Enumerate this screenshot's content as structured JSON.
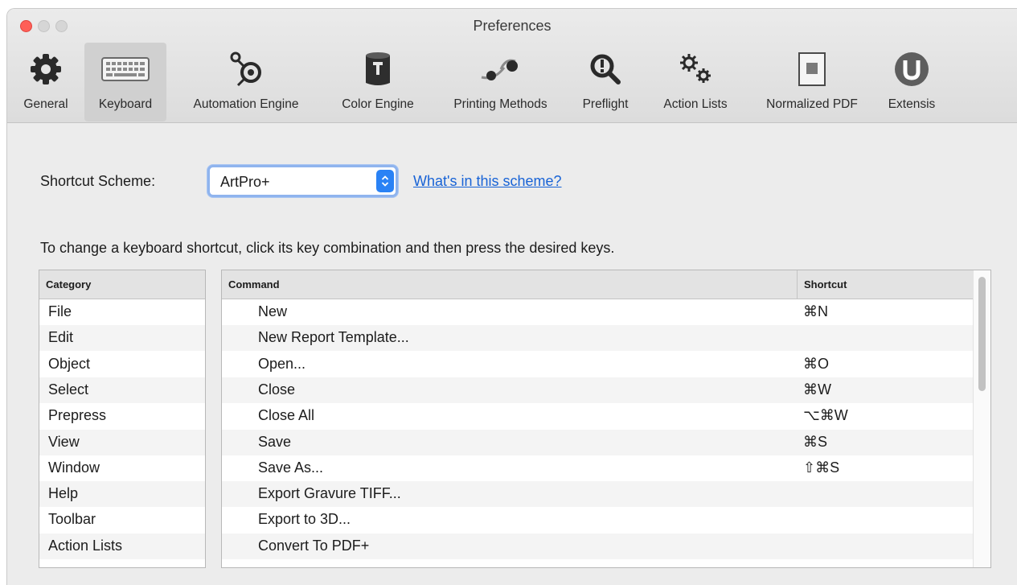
{
  "window": {
    "title": "Preferences"
  },
  "toolbar": {
    "items": [
      {
        "label": "General",
        "icon": "gear-icon",
        "selected": false
      },
      {
        "label": "Keyboard",
        "icon": "keyboard-icon",
        "selected": true
      },
      {
        "label": "Automation Engine",
        "icon": "automation-icon",
        "selected": false
      },
      {
        "label": "Color Engine",
        "icon": "color-engine-icon",
        "selected": false
      },
      {
        "label": "Printing Methods",
        "icon": "printing-methods-icon",
        "selected": false
      },
      {
        "label": "Preflight",
        "icon": "preflight-icon",
        "selected": false
      },
      {
        "label": "Action Lists",
        "icon": "action-lists-icon",
        "selected": false
      },
      {
        "label": "Normalized PDF",
        "icon": "normalized-pdf-icon",
        "selected": false
      },
      {
        "label": "Extensis",
        "icon": "extensis-icon",
        "selected": false
      }
    ]
  },
  "scheme": {
    "label": "Shortcut Scheme:",
    "selected": "ArtPro+",
    "link": "What's in this scheme?"
  },
  "instructions": "To change a keyboard shortcut, click its key combination and then press the desired keys.",
  "categories": {
    "header": "Category",
    "items": [
      "File",
      "Edit",
      "Object",
      "Select",
      "Prepress",
      "View",
      "Window",
      "Help",
      "Toolbar",
      "Action Lists"
    ]
  },
  "commands": {
    "headers": {
      "command": "Command",
      "shortcut": "Shortcut"
    },
    "rows": [
      {
        "command": "New",
        "shortcut": "⌘N"
      },
      {
        "command": "New Report Template...",
        "shortcut": ""
      },
      {
        "command": "Open...",
        "shortcut": "⌘O"
      },
      {
        "command": "Close",
        "shortcut": "⌘W"
      },
      {
        "command": "Close All",
        "shortcut": "⌥⌘W"
      },
      {
        "command": "Save",
        "shortcut": "⌘S"
      },
      {
        "command": "Save As...",
        "shortcut": "⇧⌘S"
      },
      {
        "command": "Export Gravure TIFF...",
        "shortcut": ""
      },
      {
        "command": "Export to 3D...",
        "shortcut": ""
      },
      {
        "command": "Convert To PDF+",
        "shortcut": ""
      }
    ]
  },
  "colors": {
    "accent": "#2a82f5",
    "link": "#1863d6",
    "close": "#ff5f57"
  }
}
